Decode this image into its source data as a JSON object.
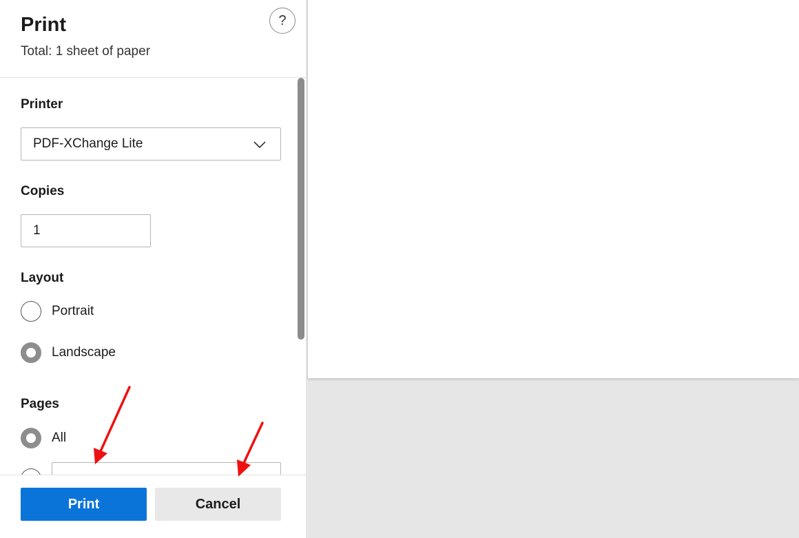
{
  "dialog": {
    "title": "Print",
    "subtitle": "Total: 1 sheet of paper",
    "help_label": "?"
  },
  "printer": {
    "label": "Printer",
    "selected": "PDF-XChange Lite"
  },
  "copies": {
    "label": "Copies",
    "value": "1"
  },
  "layout": {
    "label": "Layout",
    "options": [
      {
        "label": "Portrait",
        "selected": false
      },
      {
        "label": "Landscape",
        "selected": true
      }
    ]
  },
  "pages": {
    "label": "Pages",
    "options": [
      {
        "label": "All",
        "selected": true
      },
      {
        "label": "",
        "selected": false
      }
    ],
    "range_value": ""
  },
  "footer": {
    "print_label": "Print",
    "cancel_label": "Cancel"
  },
  "colors": {
    "accent": "#0a74d9",
    "annotation_arrow": "#ee1111"
  },
  "icons": {
    "printer_dropdown": "chevron-down-icon",
    "help": "help-icon"
  }
}
